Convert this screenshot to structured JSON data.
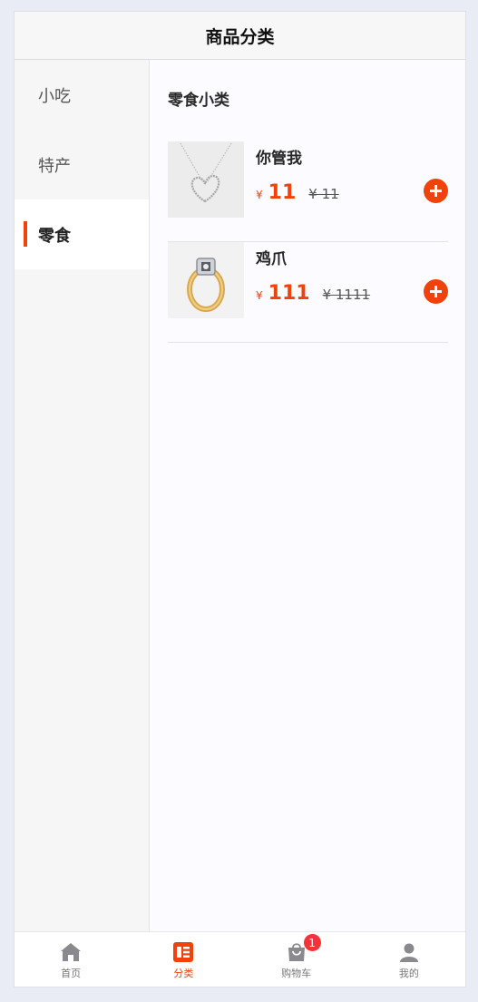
{
  "header": {
    "title": "商品分类"
  },
  "sidebar": {
    "items": [
      {
        "label": "小吃",
        "active": false
      },
      {
        "label": "特产",
        "active": false
      },
      {
        "label": "零食",
        "active": true
      }
    ]
  },
  "content": {
    "subcategory_title": "零食小类",
    "products": [
      {
        "name": "你管我",
        "currency": "¥",
        "price": "11",
        "original_price": "¥ 11",
        "image": "heart-necklace"
      },
      {
        "name": "鸡爪",
        "currency": "¥",
        "price": "111",
        "original_price": "¥ 1111",
        "image": "gold-ring"
      }
    ]
  },
  "tabbar": {
    "items": [
      {
        "label": "首页",
        "icon": "home-icon",
        "active": false
      },
      {
        "label": "分类",
        "icon": "category-icon",
        "active": true
      },
      {
        "label": "购物车",
        "icon": "cart-icon",
        "active": false,
        "badge": "1"
      },
      {
        "label": "我的",
        "icon": "user-icon",
        "active": false
      }
    ]
  },
  "colors": {
    "accent": "#f2420c",
    "badge": "#f2333c",
    "icon_inactive": "#8a8a8e"
  }
}
